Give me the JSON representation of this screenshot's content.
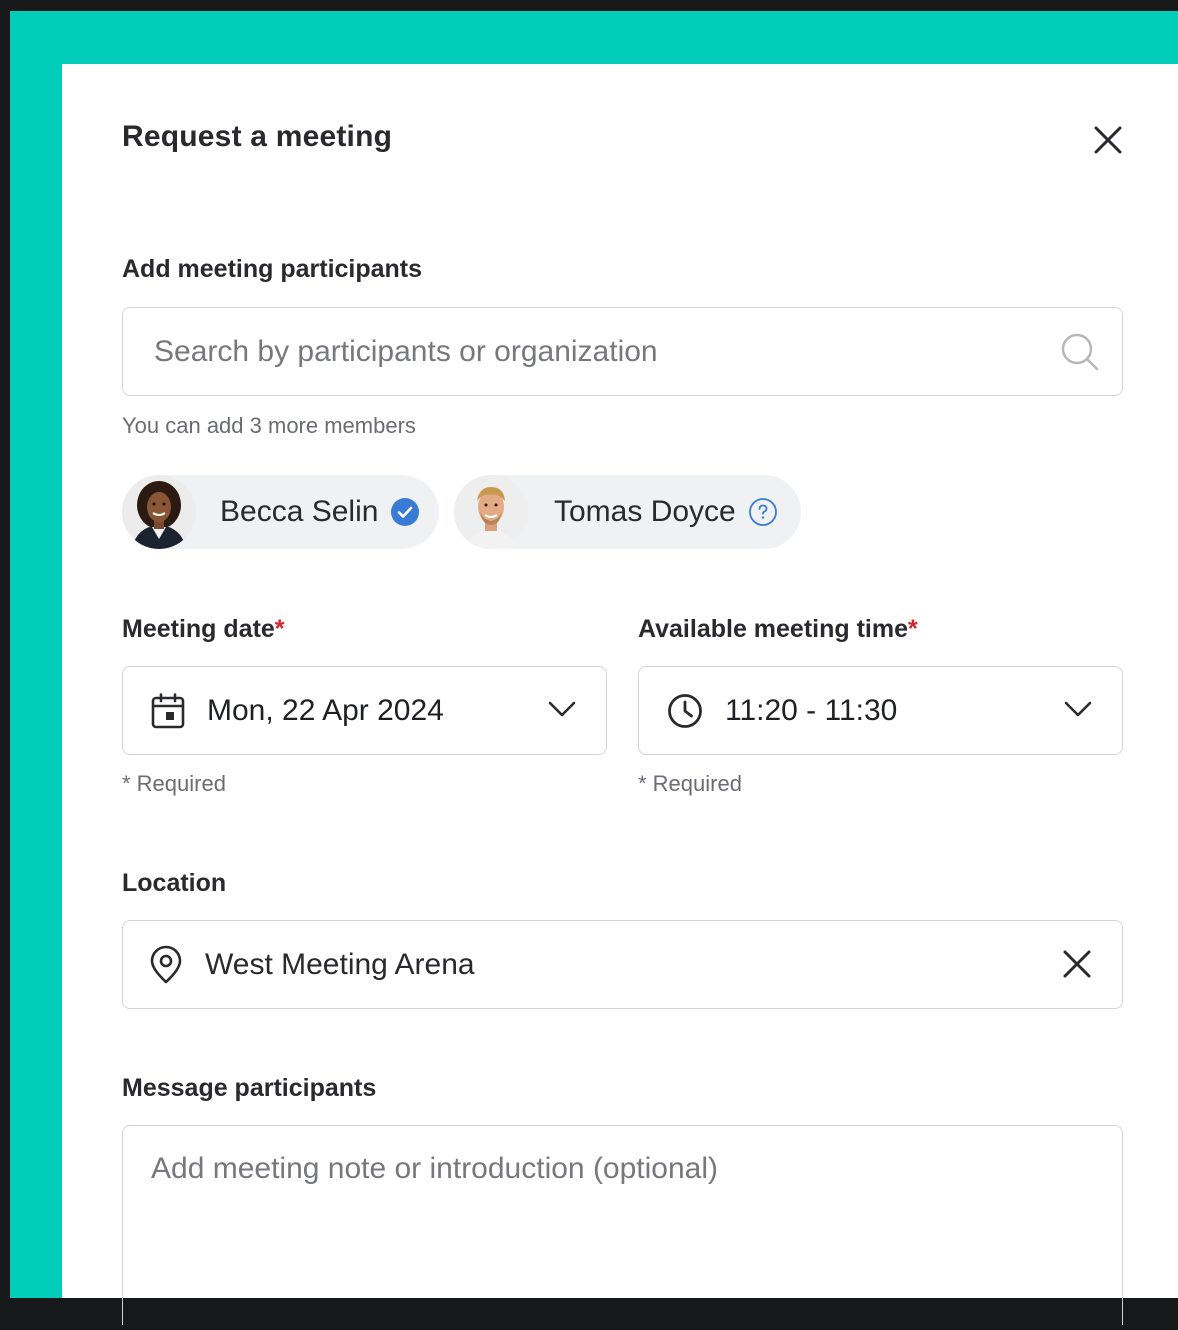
{
  "modal": {
    "title": "Request a meeting"
  },
  "participants": {
    "label": "Add meeting participants",
    "search_placeholder": "Search by participants or organization",
    "helper": "You can add 3 more members",
    "chips": [
      {
        "name": "Becca Selin",
        "status": "verified",
        "status_icon": "verified-check-icon",
        "badge_color": "#3a7bd5"
      },
      {
        "name": "Tomas Doyce",
        "status": "unverified",
        "status_icon": "question-circle-icon",
        "badge_color": "#3a7bd5"
      }
    ]
  },
  "meeting_date": {
    "label": "Meeting date",
    "required_mark": "*",
    "value": "Mon, 22 Apr 2024",
    "helper": "* Required",
    "icon": "calendar-icon"
  },
  "meeting_time": {
    "label": "Available meeting time",
    "required_mark": "*",
    "value": "11:20 - 11:30",
    "helper": "* Required",
    "icon": "clock-icon"
  },
  "location": {
    "label": "Location",
    "value": "West Meeting Arena",
    "icon": "location-pin-icon"
  },
  "message": {
    "label": "Message participants",
    "placeholder": "Add meeting note or introduction (optional)"
  },
  "colors": {
    "accent": "#00cdb9",
    "required": "#d9232e",
    "badge": "#3a7bd5",
    "outer_background": "#17181a"
  }
}
